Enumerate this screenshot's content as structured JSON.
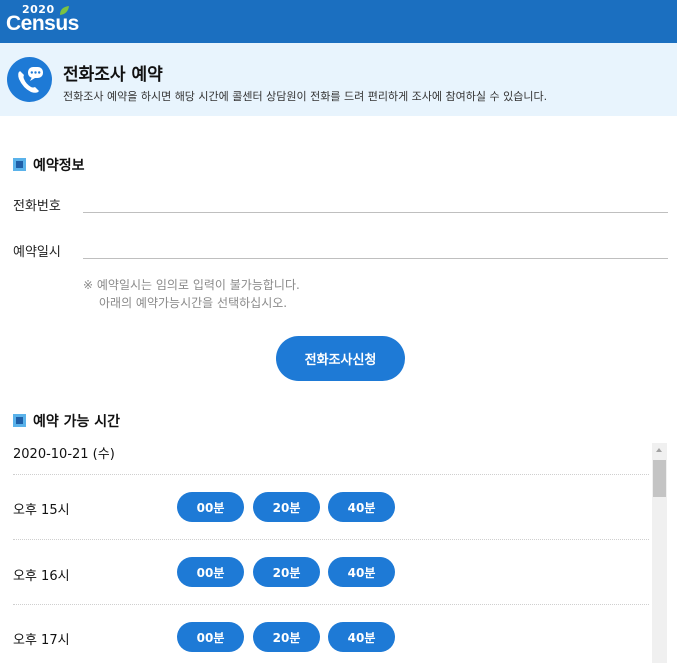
{
  "brand": {
    "year": "2020",
    "name": "Census"
  },
  "header": {
    "title": "전화조사 예약",
    "description": "전화조사 예약을 하시면 해당 시간에 콜센터 상담원이 전화를 드려 편리하게 조사에 참여하실 수 있습니다."
  },
  "reservation": {
    "section_title": "예약정보",
    "phone_label": "전화번호",
    "phone_value": "",
    "datetime_label": "예약일시",
    "datetime_value": "",
    "notice_line1": "※ 예약일시는 임의로 입력이 불가능합니다.",
    "notice_line2": "아래의 예약가능시간을 선택하십시오.",
    "submit_label": "전화조사신청"
  },
  "availability": {
    "section_title": "예약 가능 시간",
    "date": "2020-10-21 (수)",
    "rows": [
      {
        "hour": "오후 15시",
        "slots": [
          "00분",
          "20분",
          "40분"
        ]
      },
      {
        "hour": "오후 16시",
        "slots": [
          "00분",
          "20분",
          "40분"
        ]
      },
      {
        "hour": "오후 17시",
        "slots": [
          "00분",
          "20분",
          "40분"
        ]
      }
    ]
  },
  "colors": {
    "topbar": "#1b6fc0",
    "header_bg": "#e8f4fd",
    "accent": "#1e7ad6",
    "leaf": "#7cc242"
  },
  "icons": {
    "phone": "phone-chat-icon",
    "leaf": "leaf-icon",
    "section": "square-bullet-icon"
  }
}
